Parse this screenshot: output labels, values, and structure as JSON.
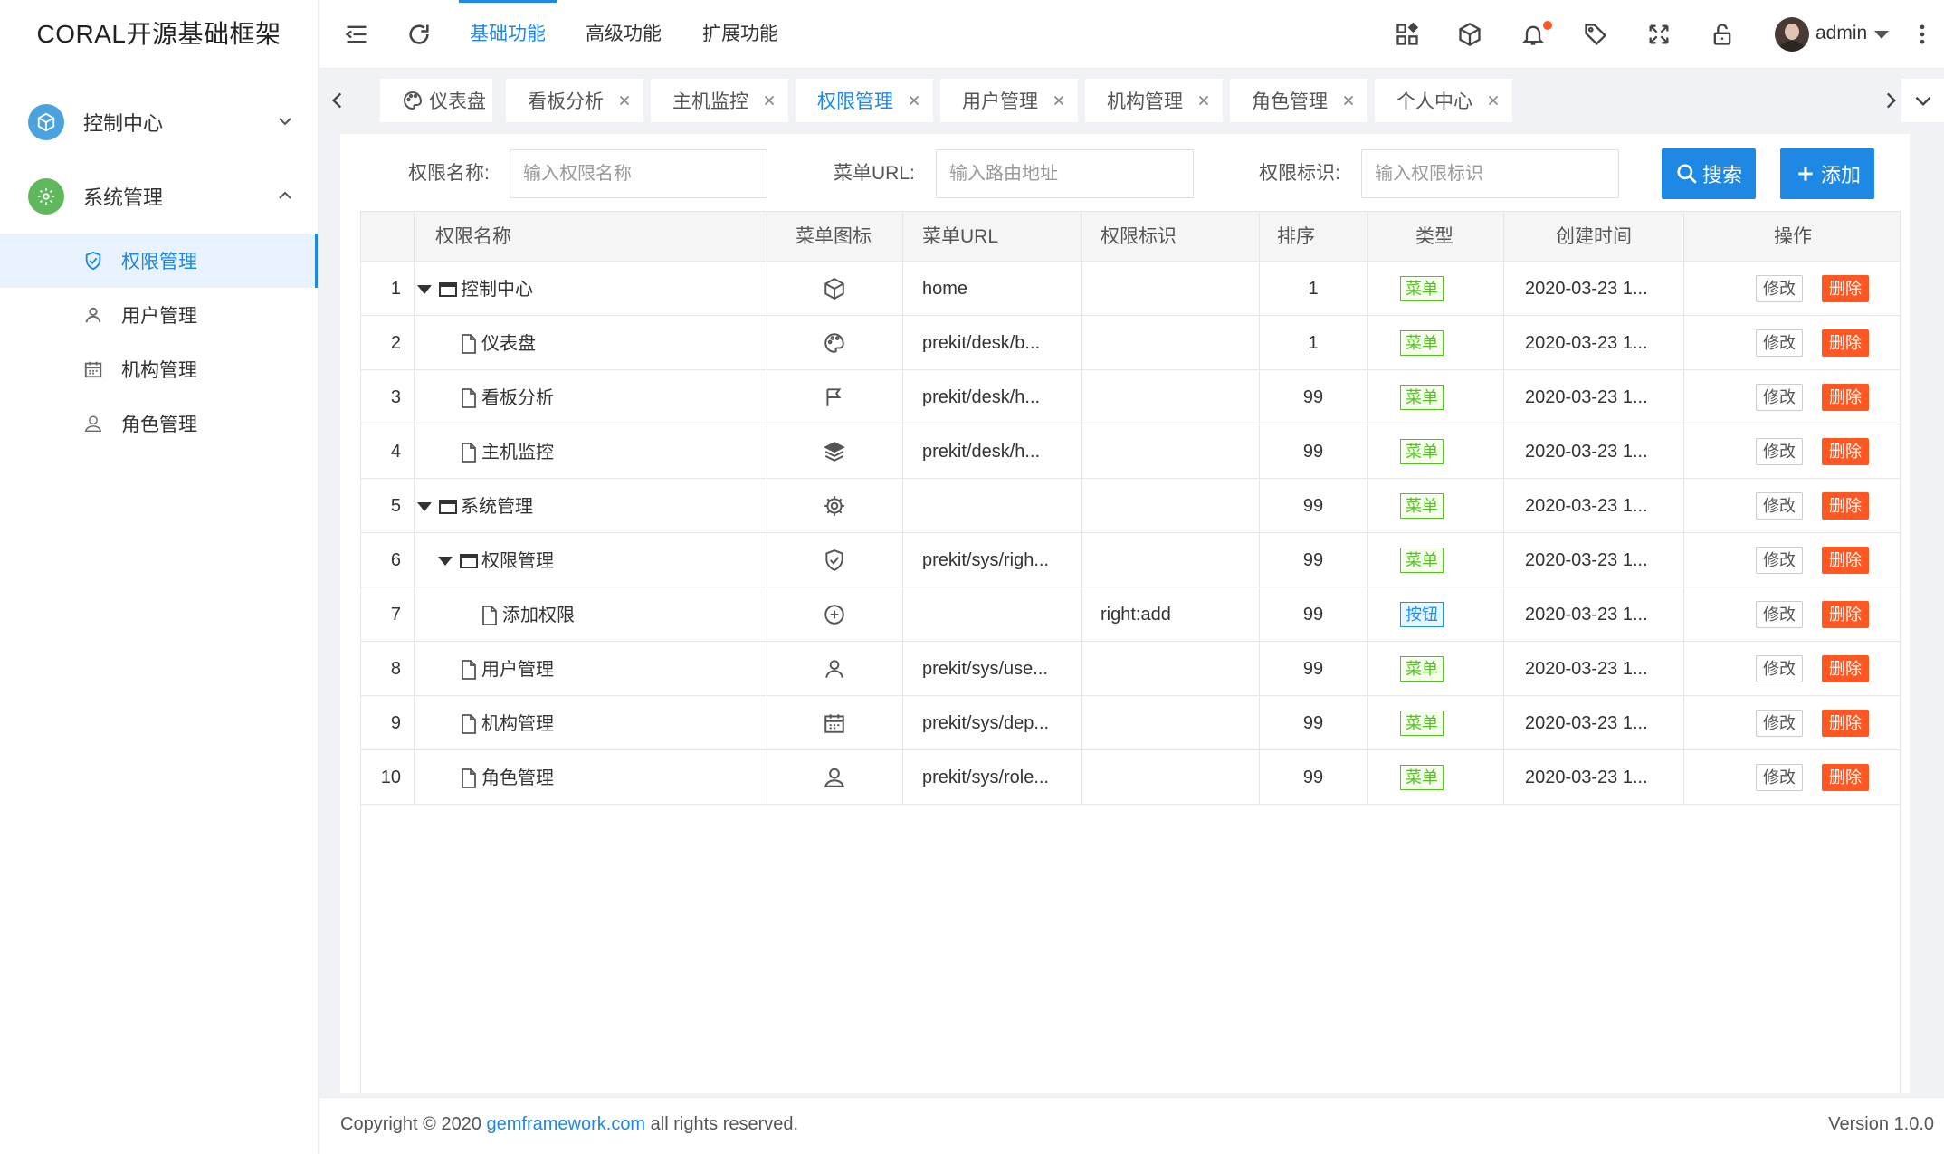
{
  "app": {
    "title": "CORAL开源基础框架"
  },
  "sidebar": {
    "groups": [
      {
        "label": "控制中心",
        "icon": "cube-icon",
        "color": "#4aa3df",
        "expanded": false
      },
      {
        "label": "系统管理",
        "icon": "gear-icon",
        "color": "#5fb85c",
        "expanded": true
      }
    ],
    "items": [
      {
        "label": "权限管理",
        "icon": "shield-check-icon",
        "active": true
      },
      {
        "label": "用户管理",
        "icon": "user-icon",
        "active": false
      },
      {
        "label": "机构管理",
        "icon": "calendar-icon",
        "active": false
      },
      {
        "label": "角色管理",
        "icon": "user-outline-icon",
        "active": false
      }
    ]
  },
  "topbar": {
    "nav": [
      "基础功能",
      "高级功能",
      "扩展功能"
    ],
    "active_nav": "基础功能",
    "user": "admin",
    "icons": [
      "menu-fold-icon",
      "refresh-icon",
      "app-grid-icon",
      "cube-icon",
      "bell-icon",
      "tag-icon",
      "fullscreen-icon",
      "lock-icon",
      "more-vertical-icon"
    ]
  },
  "tabs": [
    {
      "label": "仪表盘",
      "closable": false,
      "active": false
    },
    {
      "label": "看板分析",
      "closable": true,
      "active": false
    },
    {
      "label": "主机监控",
      "closable": true,
      "active": false
    },
    {
      "label": "权限管理",
      "closable": true,
      "active": true
    },
    {
      "label": "用户管理",
      "closable": true,
      "active": false
    },
    {
      "label": "机构管理",
      "closable": true,
      "active": false
    },
    {
      "label": "角色管理",
      "closable": true,
      "active": false
    },
    {
      "label": "个人中心",
      "closable": true,
      "active": false
    }
  ],
  "search": {
    "name_label": "权限名称:",
    "name_placeholder": "输入权限名称",
    "url_label": "菜单URL:",
    "url_placeholder": "输入路由地址",
    "key_label": "权限标识:",
    "key_placeholder": "输入权限标识",
    "search_button": "搜索",
    "add_button": "添加"
  },
  "table": {
    "headers": [
      "",
      "权限名称",
      "菜单图标",
      "菜单URL",
      "权限标识",
      "排序",
      "类型",
      "创建时间",
      "操作"
    ],
    "edit_label": "修改",
    "delete_label": "删除",
    "rows": [
      {
        "no": "1",
        "name": "控制中心",
        "level": 0,
        "folder": true,
        "icon": "cube-icon",
        "url": "home",
        "key": "",
        "order": "1",
        "type": "菜单",
        "type_kind": "menu",
        "created": "2020-03-23 1..."
      },
      {
        "no": "2",
        "name": "仪表盘",
        "level": 1,
        "folder": false,
        "icon": "palette-icon",
        "url": "prekit/desk/b...",
        "key": "",
        "order": "1",
        "type": "菜单",
        "type_kind": "menu",
        "created": "2020-03-23 1..."
      },
      {
        "no": "3",
        "name": "看板分析",
        "level": 1,
        "folder": false,
        "icon": "flag-icon",
        "url": "prekit/desk/h...",
        "key": "",
        "order": "99",
        "type": "菜单",
        "type_kind": "menu",
        "created": "2020-03-23 1..."
      },
      {
        "no": "4",
        "name": "主机监控",
        "level": 1,
        "folder": false,
        "icon": "layers-icon",
        "url": "prekit/desk/h...",
        "key": "",
        "order": "99",
        "type": "菜单",
        "type_kind": "menu",
        "created": "2020-03-23 1..."
      },
      {
        "no": "5",
        "name": "系统管理",
        "level": 0,
        "folder": true,
        "icon": "gear-icon",
        "url": "",
        "key": "",
        "order": "99",
        "type": "菜单",
        "type_kind": "menu",
        "created": "2020-03-23 1..."
      },
      {
        "no": "6",
        "name": "权限管理",
        "level": 1,
        "folder": true,
        "icon": "shield-check-icon",
        "url": "prekit/sys/righ...",
        "key": "",
        "order": "99",
        "type": "菜单",
        "type_kind": "menu",
        "created": "2020-03-23 1..."
      },
      {
        "no": "7",
        "name": "添加权限",
        "level": 2,
        "folder": false,
        "icon": "plus-circle-icon",
        "url": "",
        "key": "right:add",
        "order": "99",
        "type": "按钮",
        "type_kind": "button",
        "created": "2020-03-23 1..."
      },
      {
        "no": "8",
        "name": "用户管理",
        "level": 1,
        "folder": false,
        "icon": "user-icon",
        "url": "prekit/sys/use...",
        "key": "",
        "order": "99",
        "type": "菜单",
        "type_kind": "menu",
        "created": "2020-03-23 1..."
      },
      {
        "no": "9",
        "name": "机构管理",
        "level": 1,
        "folder": false,
        "icon": "calendar-icon",
        "url": "prekit/sys/dep...",
        "key": "",
        "order": "99",
        "type": "菜单",
        "type_kind": "menu",
        "created": "2020-03-23 1..."
      },
      {
        "no": "10",
        "name": "角色管理",
        "level": 1,
        "folder": false,
        "icon": "user-outline-icon",
        "url": "prekit/sys/role...",
        "key": "",
        "order": "99",
        "type": "菜单",
        "type_kind": "menu",
        "created": "2020-03-23 1..."
      }
    ]
  },
  "footer": {
    "prefix": "Copyright © 2020 ",
    "link": "gemframework.com",
    "suffix": " all rights reserved.",
    "version": "Version 1.0.0"
  },
  "colors": {
    "primary": "#1e88e5",
    "danger": "#ff5722",
    "menu_tag": "#52c41a",
    "button_tag": "#1890ff"
  }
}
